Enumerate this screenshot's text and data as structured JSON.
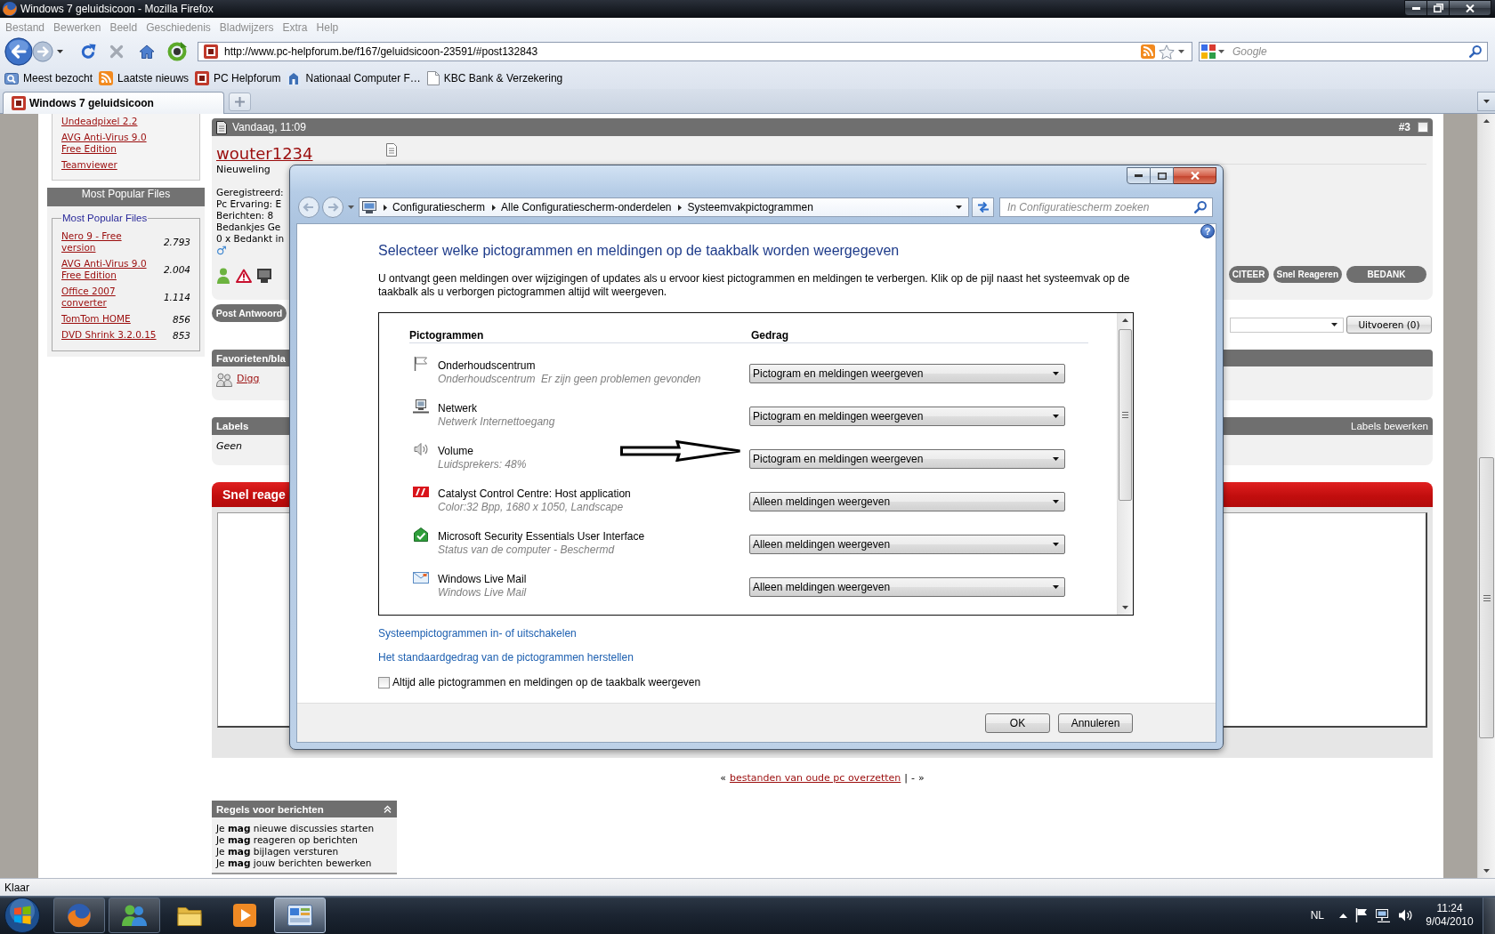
{
  "window": {
    "title": "Windows 7 geluidsicoon - Mozilla Firefox"
  },
  "menu_bar": [
    "Bestand",
    "Bewerken",
    "Beeld",
    "Geschiedenis",
    "Bladwijzers",
    "Extra",
    "Help"
  ],
  "navigation": {
    "url": "http://www.pc-helpforum.be/f167/geluidsicoon-23591/#post132843",
    "search": {
      "placeholder": "Google"
    }
  },
  "bookmarks": [
    {
      "kind": "smart",
      "label": "Meest bezocht"
    },
    {
      "kind": "feed",
      "label": "Laatste nieuws"
    },
    {
      "kind": "site",
      "label": "PC Helpforum"
    },
    {
      "kind": "building",
      "label": "Nationaal Computer F…"
    },
    {
      "kind": "page",
      "label": "KBC Bank & Verzekering"
    }
  ],
  "tabs": [
    {
      "label": "Windows 7 geluidsicoon",
      "selected": true
    }
  ],
  "sidebar": {
    "links": [
      "Undeadpixel 2.2",
      "AVG Anti-Virus 9.0 Free Edition",
      "Teamviewer"
    ],
    "popular": {
      "title": "Most Popular Files",
      "legend": "Most Popular Files",
      "items": [
        {
          "name": "Nero 9 - Free version",
          "count": "2.793"
        },
        {
          "name": "AVG Anti-Virus 9.0 Free Edition",
          "count": "2.004"
        },
        {
          "name": "Office 2007 converter",
          "count": "1.114"
        },
        {
          "name": "TomTom HOME",
          "count": "856"
        },
        {
          "name": "DVD Shrink 3.2.0.15",
          "count": "853"
        }
      ]
    }
  },
  "post": {
    "date": "Vandaag, 11:09",
    "number": "#3",
    "checked": false,
    "author": "wouter1234",
    "rank": "Nieuweling",
    "details": [
      "Geregistreerd:",
      "Pc Ervaring: E",
      "Berichten: 8",
      "Bedankjes Ge",
      "0 x Bedankt in"
    ],
    "gender": "♂",
    "buttons": [
      "CITEER",
      "Snel Reageren",
      "BEDANK"
    ]
  },
  "reply_bar": {
    "button": "Post Antwoord",
    "action": "Uitvoeren (0)"
  },
  "favorites": {
    "title": "Favorieten/bla",
    "items": [
      "Digg"
    ]
  },
  "labels": {
    "title": "Labels",
    "action": "Labels bewerken",
    "value": "Geen"
  },
  "quick_reply": {
    "title": "Snel reage"
  },
  "thread_nav": {
    "previous_mark": "«",
    "link": "bestanden van oude pc overzetten",
    "separator": "|",
    "next": "-",
    "next_mark": "»"
  },
  "rules": {
    "title": "Regels voor berichten",
    "lines": [
      "Je **mag** nieuwe discussies starten",
      "Je **mag** reageren op berichten",
      "Je **mag** bijlagen versturen",
      "Je **mag** jouw berichten bewerken"
    ]
  },
  "dialog": {
    "breadcrumb": [
      "Configuratiescherm",
      "Alle Configuratiescherm-onderdelen",
      "Systeemvakpictogrammen"
    ],
    "search": {
      "placeholder": "In Configuratiescherm zoeken"
    },
    "help": "?",
    "heading": "Selecteer welke pictogrammen en meldingen op de taakbalk worden weergegeven",
    "description": "U ontvangt geen meldingen over wijzigingen of updates als u ervoor kiest pictogrammen en meldingen te verbergen. Klik op de pijl naast het systeemvak op de taakbalk als u verborgen pictogrammen altijd wilt weergeven.",
    "columns": [
      "Pictogrammen",
      "Gedrag"
    ],
    "rows": [
      {
        "kind": "flag",
        "name": "Onderhoudscentrum",
        "detail": "Onderhoudscentrum  Er zijn geen problemen gevonden",
        "behavior": "Pictogram en meldingen weergeven"
      },
      {
        "kind": "network",
        "name": "Netwerk",
        "detail": "Netwerk Internettoegang",
        "behavior": "Pictogram en meldingen weergeven"
      },
      {
        "kind": "speaker",
        "name": "Volume",
        "detail": "Luidsprekers: 48%",
        "behavior": "Pictogram en meldingen weergeven"
      },
      {
        "kind": "logo",
        "name": "Catalyst Control Centre: Host application",
        "detail": "Color:32 Bpp, 1680 x 1050, Landscape",
        "behavior": "Alleen meldingen weergeven"
      },
      {
        "kind": "shield",
        "name": "Microsoft Security Essentials User Interface",
        "detail": "Status van de computer - Beschermd",
        "behavior": "Alleen meldingen weergeven"
      },
      {
        "kind": "mail",
        "name": "Windows Live Mail",
        "detail": "Windows Live Mail",
        "behavior": "Alleen meldingen weergeven"
      }
    ],
    "links": [
      "Systeempictogrammen in- of uitschakelen",
      "Het standaardgedrag van de pictogrammen herstellen"
    ],
    "always_show": {
      "label": "Altijd alle pictogrammen en meldingen op de taakbalk weergeven",
      "checked": false
    },
    "buttons": [
      "OK",
      "Annuleren"
    ]
  },
  "status_bar": {
    "text": "Klaar"
  },
  "taskbar": {
    "apps": [
      {
        "kind": "browser",
        "running": true,
        "selected": false
      },
      {
        "kind": "messenger",
        "running": true,
        "selected": false
      },
      {
        "kind": "folder",
        "running": false,
        "selected": false
      },
      {
        "kind": "media",
        "running": false,
        "selected": false
      },
      {
        "kind": "control_panel",
        "running": true,
        "selected": true
      }
    ],
    "language": "NL",
    "time": "11:24",
    "date": "9/04/2010"
  }
}
